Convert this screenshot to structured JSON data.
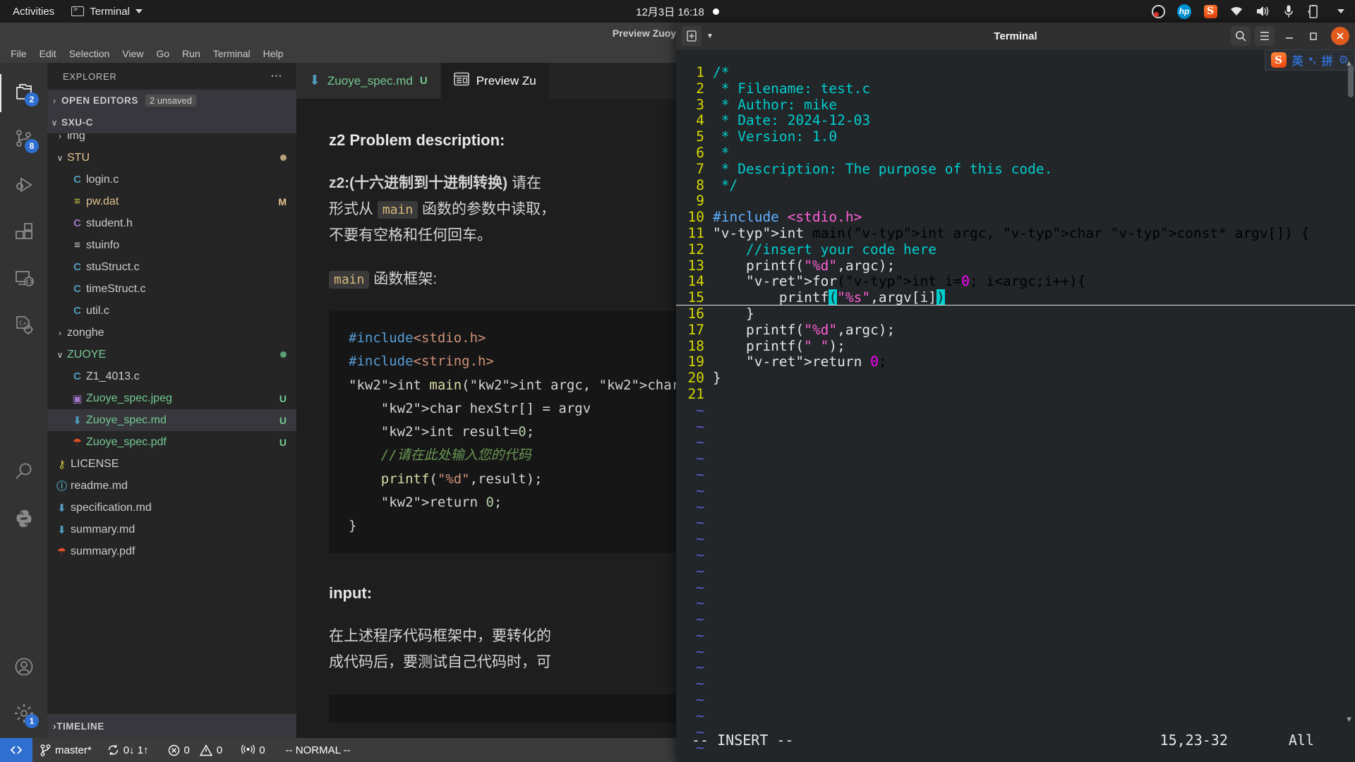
{
  "gnome": {
    "activities": "Activities",
    "app_name": "Terminal",
    "clock": "12月3日  16:18",
    "tray": [
      "obs-icon",
      "hp-icon",
      "sogou-icon",
      "wifi-icon",
      "volume-icon",
      "microphone-icon",
      "battery-icon",
      "chevron-down-icon"
    ]
  },
  "vscode": {
    "window_title": "Preview Zuoye_spec.md - S",
    "menu": [
      "File",
      "Edit",
      "Selection",
      "View",
      "Go",
      "Run",
      "Terminal",
      "Help"
    ],
    "activity_bar": [
      {
        "name": "explorer",
        "badge": "2"
      },
      {
        "name": "source-control",
        "badge": "8"
      },
      {
        "name": "run-and-debug",
        "badge": ""
      },
      {
        "name": "extensions",
        "badge": ""
      },
      {
        "name": "remote-explorer",
        "badge": ""
      },
      {
        "name": "c-cpp-config",
        "badge": ""
      },
      {
        "name": "search",
        "badge": ""
      },
      {
        "name": "python",
        "badge": ""
      },
      {
        "name": "accounts",
        "badge": ""
      },
      {
        "name": "settings",
        "badge": "1"
      }
    ],
    "explorer": {
      "title": "EXPLORER",
      "open_editors_label": "OPEN EDITORS",
      "open_editors_badge": "2 unsaved",
      "workspace_label": "SXU-C",
      "timeline_label": "TIMELINE",
      "tree": [
        {
          "name": "img",
          "type": "folder",
          "indent": 1,
          "twisty": "›",
          "status": "",
          "icon": "",
          "color": "#cccccc",
          "dot": ""
        },
        {
          "name": "STU",
          "type": "folder",
          "indent": 1,
          "twisty": "∨",
          "status": "",
          "icon": "",
          "color": "#e2c08d",
          "dot": "#b5a179"
        },
        {
          "name": "login.c",
          "type": "file",
          "indent": 2,
          "twisty": "",
          "status": "",
          "icon": "C",
          "color": "#cccccc",
          "icon_color": "#519aba",
          "dot": ""
        },
        {
          "name": "pw.dat",
          "type": "file",
          "indent": 2,
          "twisty": "",
          "status": "M",
          "icon": "≡",
          "color": "#e2c08d",
          "icon_color": "#cbcb41",
          "dot": ""
        },
        {
          "name": "student.h",
          "type": "file",
          "indent": 2,
          "twisty": "",
          "status": "",
          "icon": "C",
          "color": "#cccccc",
          "icon_color": "#a074c4",
          "dot": ""
        },
        {
          "name": "stuinfo",
          "type": "file",
          "indent": 2,
          "twisty": "",
          "status": "",
          "icon": "≡",
          "color": "#cccccc",
          "icon_color": "#cccccc",
          "dot": ""
        },
        {
          "name": "stuStruct.c",
          "type": "file",
          "indent": 2,
          "twisty": "",
          "status": "",
          "icon": "C",
          "color": "#cccccc",
          "icon_color": "#519aba",
          "dot": ""
        },
        {
          "name": "timeStruct.c",
          "type": "file",
          "indent": 2,
          "twisty": "",
          "status": "",
          "icon": "C",
          "color": "#cccccc",
          "icon_color": "#519aba",
          "dot": ""
        },
        {
          "name": "util.c",
          "type": "file",
          "indent": 2,
          "twisty": "",
          "status": "",
          "icon": "C",
          "color": "#cccccc",
          "icon_color": "#519aba",
          "dot": ""
        },
        {
          "name": "zonghe",
          "type": "folder",
          "indent": 1,
          "twisty": "›",
          "status": "",
          "icon": "",
          "color": "#cccccc",
          "dot": ""
        },
        {
          "name": "ZUOYE",
          "type": "folder",
          "indent": 1,
          "twisty": "∨",
          "status": "",
          "icon": "",
          "color": "#73c991",
          "dot": "#5b9e72"
        },
        {
          "name": "Z1_4013.c",
          "type": "file",
          "indent": 2,
          "twisty": "",
          "status": "",
          "icon": "C",
          "color": "#cccccc",
          "icon_color": "#519aba",
          "dot": ""
        },
        {
          "name": "Zuoye_spec.jpeg",
          "type": "file",
          "indent": 2,
          "twisty": "",
          "status": "U",
          "icon": "▣",
          "color": "#73c991",
          "icon_color": "#a074c4",
          "dot": ""
        },
        {
          "name": "Zuoye_spec.md",
          "type": "file",
          "indent": 2,
          "twisty": "",
          "status": "U",
          "icon": "⬇",
          "color": "#73c991",
          "icon_color": "#519aba",
          "dot": "",
          "selected": true
        },
        {
          "name": "Zuoye_spec.pdf",
          "type": "file",
          "indent": 2,
          "twisty": "",
          "status": "U",
          "icon": "☂",
          "color": "#73c991",
          "icon_color": "#e34f26",
          "dot": ""
        },
        {
          "name": "LICENSE",
          "type": "file",
          "indent": 1,
          "twisty": "",
          "status": "",
          "icon": "⚷",
          "color": "#cccccc",
          "icon_color": "#cbcb41",
          "dot": ""
        },
        {
          "name": "readme.md",
          "type": "file",
          "indent": 1,
          "twisty": "",
          "status": "",
          "icon": "ⓘ",
          "color": "#cccccc",
          "icon_color": "#519aba",
          "dot": ""
        },
        {
          "name": "specification.md",
          "type": "file",
          "indent": 1,
          "twisty": "",
          "status": "",
          "icon": "⬇",
          "color": "#cccccc",
          "icon_color": "#519aba",
          "dot": ""
        },
        {
          "name": "summary.md",
          "type": "file",
          "indent": 1,
          "twisty": "",
          "status": "",
          "icon": "⬇",
          "color": "#cccccc",
          "icon_color": "#519aba",
          "dot": ""
        },
        {
          "name": "summary.pdf",
          "type": "file",
          "indent": 1,
          "twisty": "",
          "status": "",
          "icon": "☂",
          "color": "#cccccc",
          "icon_color": "#e34f26",
          "dot": ""
        }
      ]
    },
    "tabs": [
      {
        "label": "Zuoye_spec.md",
        "state": "U",
        "icon": "markdown-icon",
        "active": false
      },
      {
        "label": "Preview Zu",
        "state": "",
        "icon": "preview-icon",
        "active": true
      }
    ],
    "preview": {
      "heading": "z2 Problem description:",
      "para1_bold": "z2:(十六进制到十进制转换)",
      "para1_rest": " 请在",
      "para1_line2_a": "形式从 ",
      "para1_code": "main",
      "para1_line2_b": " 函数的参数中读取，",
      "para1_line3": "不要有空格和任何回车。",
      "frame_code_label": "main",
      "frame_label": " 函数框架:",
      "code_lines": [
        "#include<stdio.h>",
        "#include<string.h>",
        "int main(int argc, char",
        "    char hexStr[] = argv",
        "    int result=0;",
        "    //请在此处输入您的代码",
        "    printf(\"%d\",result);",
        "    return 0;",
        "}"
      ],
      "input_heading": "input:",
      "para2_line1": "在上述程序代码框架中，要转化的",
      "para2_line2": "成代码后，要测试自己代码时，可"
    },
    "status_bar": {
      "remote_icon": "remote-window-icon",
      "branch": "master*",
      "sync": "0↓ 1↑",
      "errors": "0",
      "warnings": "0",
      "ports": "0",
      "vim_mode": "-- NORMAL --"
    }
  },
  "terminal": {
    "title": "Terminal",
    "buttons": [
      "new-tab-button",
      "dropdown-caret",
      "search-icon",
      "menu-icon",
      "minimize-button",
      "maximize-button",
      "close-button"
    ],
    "ime": {
      "logo": "sogou-icon",
      "mode": "英",
      "punct": "•,",
      "method": "拼",
      "gear": "⚙"
    },
    "code": [
      {
        "n": "1",
        "t": "/*"
      },
      {
        "n": "2",
        "t": " * Filename: test.c"
      },
      {
        "n": "3",
        "t": " * Author: mike"
      },
      {
        "n": "4",
        "t": " * Date: 2024-12-03"
      },
      {
        "n": "5",
        "t": " * Version: 1.0"
      },
      {
        "n": "6",
        "t": " *"
      },
      {
        "n": "7",
        "t": " * Description: The purpose of this code."
      },
      {
        "n": "8",
        "t": " */"
      },
      {
        "n": "9",
        "t": ""
      },
      {
        "n": "10",
        "t": "#include <stdio.h>"
      },
      {
        "n": "11",
        "t": "int main(int argc, char const* argv[]) {"
      },
      {
        "n": "12",
        "t": "    //insert your code here"
      },
      {
        "n": "13",
        "t": "    printf(\"%d\",argc);"
      },
      {
        "n": "14",
        "t": "    for(int i=0; i<argc;i++){"
      },
      {
        "n": "15",
        "t": "        printf(\"%s\",argv[i])"
      },
      {
        "n": "16",
        "t": "    }"
      },
      {
        "n": "17",
        "t": "    printf(\"%d\",argc);"
      },
      {
        "n": "18",
        "t": "    printf(\" \");"
      },
      {
        "n": "19",
        "t": "    return 0;"
      },
      {
        "n": "20",
        "t": "}"
      },
      {
        "n": "21",
        "t": ""
      }
    ],
    "status": {
      "mode": "-- INSERT --",
      "position": "15,23-32",
      "scroll": "All"
    }
  }
}
